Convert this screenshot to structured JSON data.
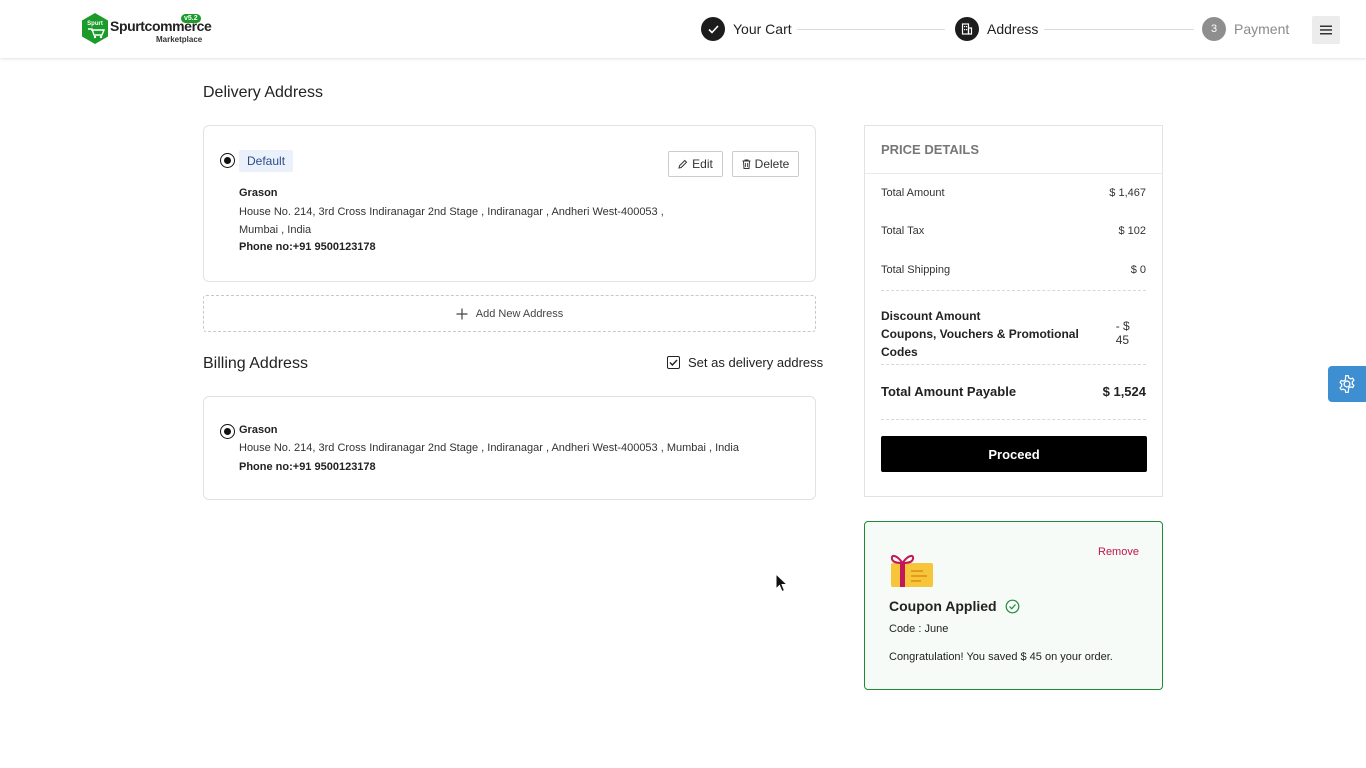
{
  "brand": {
    "name": "Spurtcommerce",
    "subtitle": "Marketplace",
    "version": "v5.2",
    "hex_badge": "Spurt",
    "accent": "#1a9b2a"
  },
  "steps": [
    {
      "number": "✓",
      "label": "Your Cart",
      "state": "done"
    },
    {
      "number": "",
      "label": "Address",
      "state": "active"
    },
    {
      "number": "3",
      "label": "Payment",
      "state": "pending"
    }
  ],
  "delivery": {
    "title": "Delivery Address",
    "badge": "Default",
    "edit_label": "Edit",
    "delete_label": "Delete",
    "name": "Grason",
    "address_line1": "House No. 214, 3rd Cross Indiranagar 2nd Stage , Indiranagar , Andheri West-400053 ,",
    "address_line2": "Mumbai , India",
    "phone": "Phone no:+91 9500123178"
  },
  "add_address_label": "Add New Address",
  "billing": {
    "title": "Billing Address",
    "same_as_delivery_label": "Set as delivery address",
    "same_as_delivery_checked": true,
    "name": "Grason",
    "address": "House No. 214, 3rd Cross Indiranagar 2nd Stage , Indiranagar , Andheri West-400053 , Mumbai , India",
    "phone": "Phone no:+91 9500123178"
  },
  "price": {
    "title": "PRICE DETAILS",
    "total_amount_label": "Total Amount",
    "total_amount": "$ 1,467",
    "total_tax_label": "Total Tax",
    "total_tax": "$ 102",
    "total_shipping_label": "Total Shipping",
    "total_shipping": "$ 0",
    "discount_label": "Discount Amount",
    "discount_sub": "Coupons, Vouchers & Promotional Codes",
    "discount": "- $ 45",
    "payable_label": "Total Amount Payable",
    "payable": "$ 1,524",
    "proceed_label": "Proceed"
  },
  "coupon": {
    "remove_label": "Remove",
    "title": "Coupon Applied",
    "code": "Code : June",
    "message": "Congratulation! You saved $ 45 on your order.",
    "border_color": "#1f8a3a"
  },
  "colors": {
    "primary": "#000000",
    "settings_tab": "#3d8fd1",
    "remove": "#c0174a"
  }
}
